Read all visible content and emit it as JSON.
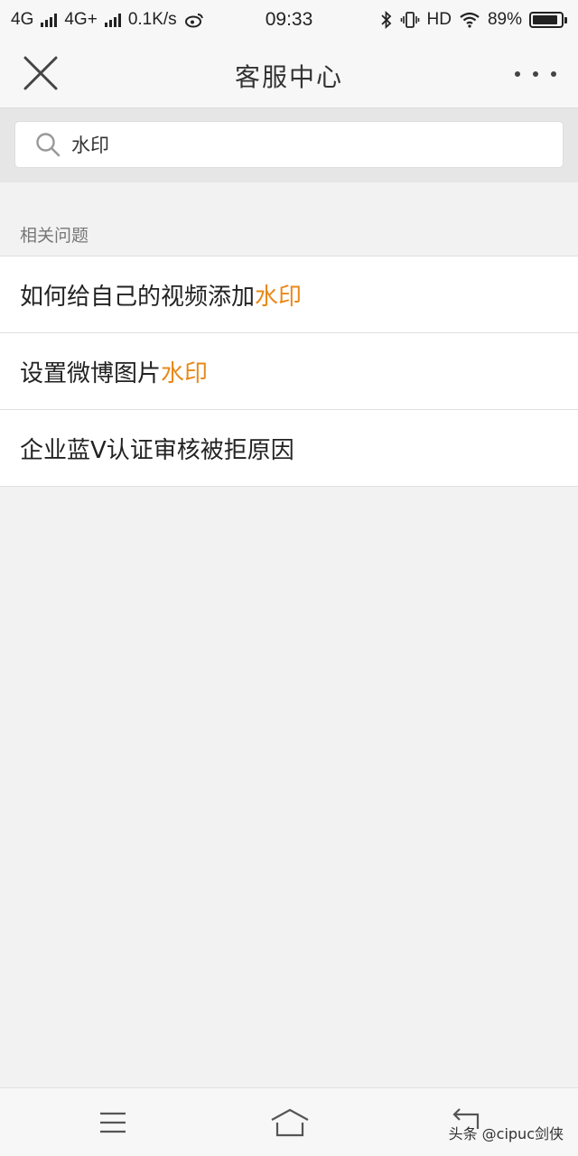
{
  "status_bar": {
    "network_1": "4G",
    "network_2": "4G+",
    "speed": "0.1K/s",
    "time": "09:33",
    "hd_label": "HD",
    "battery_pct": "89%",
    "battery_level": 0.89
  },
  "header": {
    "title": "客服中心",
    "close_icon": "close-icon",
    "more_icon": "more-icon"
  },
  "search": {
    "value": "水印",
    "placeholder": ""
  },
  "section": {
    "label": "相关问题"
  },
  "questions": [
    {
      "prefix": "如何给自己的视频添加",
      "highlight": "水印"
    },
    {
      "prefix": "设置微博图片",
      "highlight": "水印"
    },
    {
      "prefix": "企业蓝V认证审核被拒原因",
      "highlight": ""
    }
  ],
  "nav": {
    "menu_icon": "menu-icon",
    "home_icon": "home-icon",
    "back_icon": "back-icon"
  },
  "watermark": "头条 @cipuc剑侠",
  "colors": {
    "highlight": "#e8891a",
    "background": "#f2f2f2"
  }
}
